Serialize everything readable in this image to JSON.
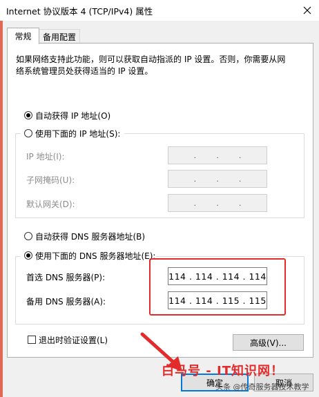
{
  "window": {
    "title": "Internet 协议版本 4 (TCP/IPv4) 属性"
  },
  "tabs": [
    "常规",
    "备用配置"
  ],
  "description": "如果网络支持此功能，则可以获取自动指派的 IP 设置。否则，你需要从网络系统管理员处获得适当的 IP 设置。",
  "ip": {
    "auto_label": "自动获得 IP 地址(O)",
    "auto_selected": true,
    "manual_label": "使用下面的 IP 地址(S):",
    "manual_selected": false,
    "fields": [
      {
        "label": "IP 地址(I):",
        "value": ".   .   ."
      },
      {
        "label": "子网掩码(U):",
        "value": ".   .   ."
      },
      {
        "label": "默认网关(D):",
        "value": ".   .   ."
      }
    ]
  },
  "dns": {
    "auto_label": "自动获得 DNS 服务器地址(B)",
    "auto_selected": false,
    "manual_label": "使用下面的 DNS 服务器地址(E):",
    "manual_selected": true,
    "preferred_label": "首选 DNS 服务器(P):",
    "preferred_value": "114 . 114 . 114 . 114",
    "alternate_label": "备用 DNS 服务器(A):",
    "alternate_value": "114 . 114 . 115 . 115"
  },
  "validate_label": "退出时验证设置(L)",
  "validate_checked": false,
  "advanced_label": "高级(V)...",
  "ok_label": "确定",
  "cancel_label": "取消",
  "overlay_text": "白马号 - IT知识网！",
  "watermark": "头条 @传奇服务器技术教学",
  "colors": {
    "highlight": "#e32b2b",
    "focus": "#0078d7"
  }
}
